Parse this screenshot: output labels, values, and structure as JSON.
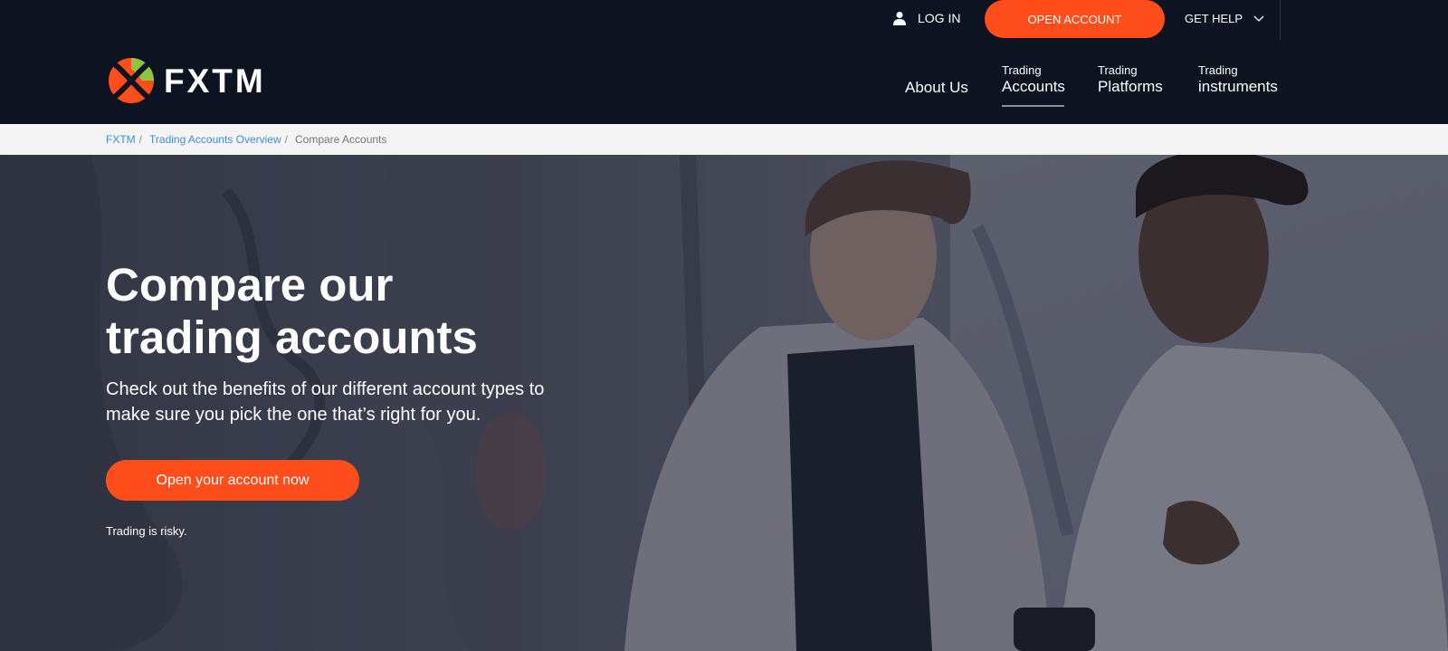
{
  "header": {
    "login_label": "LOG IN",
    "open_account_label": "OPEN ACCOUNT",
    "get_help_label": "GET HELP",
    "logo_text": "FXTM",
    "nav": {
      "about": "About Us",
      "accounts_sub": "Trading",
      "accounts_main": "Accounts",
      "platforms_sub": "Trading",
      "platforms_main": "Platforms",
      "instruments_sub": "Trading",
      "instruments_main": "instruments"
    }
  },
  "breadcrumb": {
    "home": "FXTM",
    "overview": "Trading Accounts Overview",
    "current": "Compare Accounts",
    "separator": "/"
  },
  "hero": {
    "title_line1": "Compare our",
    "title_line2": "trading accounts",
    "subtitle_line1": "Check out the benefits of our different account types to",
    "subtitle_line2": "make sure you pick the one that’s right for you.",
    "cta_label": "Open your account now",
    "risk_note": "Trading is risky."
  },
  "colors": {
    "header_bg": "#0d1321",
    "accent": "#ff4d1c",
    "link": "#3b8fd6",
    "logo_green": "#8dc63f"
  },
  "icons": {
    "login": "user-icon",
    "help": "chevron-down-icon",
    "logo": "fxtm-logo-icon"
  }
}
